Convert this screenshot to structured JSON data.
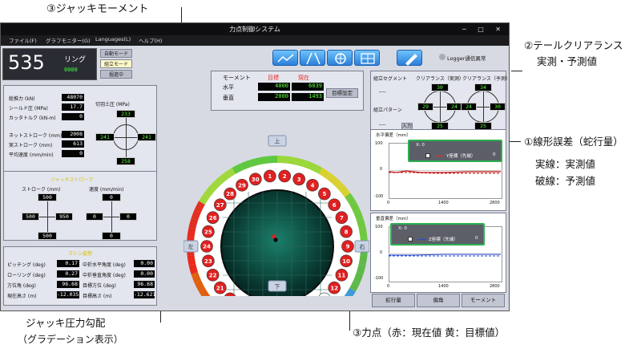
{
  "annotations": {
    "jack_moment": "③ジャッキモーメント",
    "tail_clearance_line1": "②テールクリアランス",
    "tail_clearance_line2": "実測・予測値",
    "line_error": "①線形誤差（蛇行量）",
    "solid_line": "実線：実測値",
    "dashed_line": "破線：予測値",
    "jack_gradient_line1": "ジャッキ圧力勾配",
    "jack_gradient_line2": "（グラデーション表示）",
    "force_point": "③力点（赤：現在値 黄：目標値）"
  },
  "window": {
    "title": "力点制御システム",
    "controls": "─ □ ✕"
  },
  "menu": [
    "ファイル(F)",
    "グラフモニター(G)",
    "Languages(L)",
    "ヘルプ(H)"
  ],
  "ring": {
    "number": "535",
    "label": "リング",
    "status": "0000",
    "mode_buttons": [
      "自動モード",
      "組立モード",
      "掘進中"
    ]
  },
  "logger": "Logger通信異常",
  "toolbar_icons": [
    "chart-icon",
    "road-icon",
    "compass-icon",
    "grid-icon",
    "pen-icon"
  ],
  "machine": {
    "rows": [
      {
        "label": "総推力 (kN)",
        "value": "48070"
      },
      {
        "label": "シールド圧 (MPa)",
        "value": "17.7"
      },
      {
        "label": "カッタトルク (kN-m)",
        "value": "0"
      },
      {
        "label": "ネットストローク (mm)",
        "value": "2008"
      },
      {
        "label": "実ストローク (mm)",
        "value": "613"
      },
      {
        "label": "平均速度 (mm/min)",
        "value": "0"
      }
    ],
    "cutter_label": "切羽土圧 (MPa)",
    "cutter": {
      "top": "233",
      "left": "241",
      "right": "241",
      "bottom": "258"
    }
  },
  "stroke": {
    "title": "ジャッキストローク",
    "stroke_label": "ストローク (mm)",
    "speed_label": "速度 (mm/min)",
    "stroke_vals": {
      "top": "500",
      "left": "500",
      "right": "950",
      "bottom": "500"
    },
    "speed_vals": {
      "top": "0",
      "left": "0",
      "right": "0",
      "bottom": "0"
    }
  },
  "attitude": {
    "title": "マシン姿勢",
    "left": [
      {
        "label": "ピッチング (deg)",
        "value": "0.17"
      },
      {
        "label": "ローリング (deg)",
        "value": "0.27"
      },
      {
        "label": "方位角 (deg)",
        "value": "96.68"
      },
      {
        "label": "現在高さ (m)",
        "value": "-12.035"
      }
    ],
    "right": [
      {
        "label": "中折水平角度 (deg)",
        "value": "0.00"
      },
      {
        "label": "中折垂直角度 (deg)",
        "value": "0.00"
      },
      {
        "label": "目標方位 (deg)",
        "value": "96.68"
      },
      {
        "label": "目標高さ (m)",
        "value": "-12.621"
      }
    ]
  },
  "moment": {
    "col_label": "モーメント",
    "col_target": "目標",
    "col_current": "現在",
    "rows": [
      {
        "label": "水平",
        "target": "4000",
        "current": "6039"
      },
      {
        "label": "垂直",
        "target": "2000",
        "current": "1493"
      }
    ],
    "set_button": "目標設定"
  },
  "gauge": {
    "up": "上",
    "down": "下",
    "left": "左",
    "right": "右",
    "red_jacks": [
      "1",
      "2",
      "3",
      "4",
      "5",
      "6",
      "7",
      "8",
      "9",
      "10",
      "11",
      "12",
      "18",
      "19",
      "20",
      "21",
      "22",
      "23",
      "24",
      "25",
      "26",
      "27",
      "28",
      "29",
      "30"
    ],
    "white_jacks": [
      "13",
      "14",
      "15",
      "16",
      "17"
    ]
  },
  "clearance": {
    "segment_label": "組立セグメント",
    "segment_value": "----",
    "pattern_label": "組立パターン",
    "pattern_value": "----",
    "input_button": "入力",
    "actual_title": "クリアランス（実測）",
    "predict_title": "クリアランス（予測）",
    "actual": {
      "top": "30",
      "left": "29",
      "right": "24",
      "bottom": "25"
    },
    "predict": {
      "top": "34",
      "left": "24",
      "right": "30",
      "bottom": "25"
    }
  },
  "charts": [
    {
      "title": "水平偏差（mm）",
      "ytick_top": "100",
      "ytick_mid": "0",
      "ytick_bot": "-100",
      "x_ticks": [
        "0",
        "1400",
        "2800"
      ],
      "popup_x": "X: 0",
      "popup_series": "Y座標（先端）",
      "popup_value": "0"
    },
    {
      "title": "垂直偏差（mm）",
      "ytick_top": "100",
      "ytick_mid": "0",
      "ytick_bot": "-100",
      "x_ticks": [
        "0",
        "1400",
        "2800"
      ],
      "popup_x": "X: 0",
      "popup_series": "Z座標（先端）",
      "popup_value": "0"
    }
  ],
  "bottom_buttons": [
    "蛇行量",
    "偏角",
    "モーメント"
  ]
}
